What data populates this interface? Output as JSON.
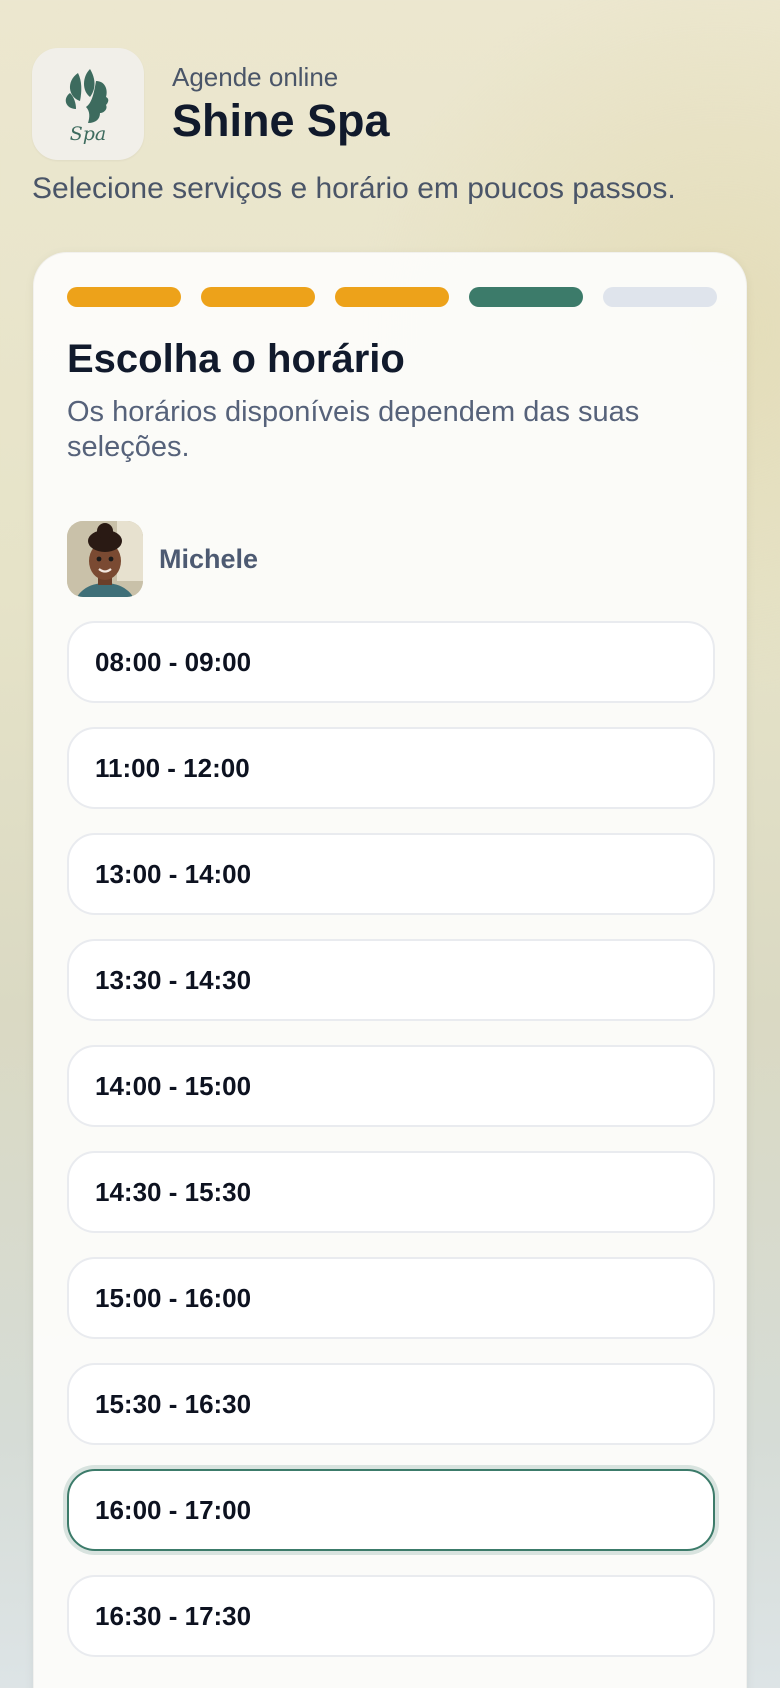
{
  "app": {
    "subtitle": "Agende online",
    "title": "Shine Spa",
    "logo_text": "Spa",
    "tagline": "Selecione serviços e horário em poucos passos."
  },
  "wizard": {
    "steps": [
      "done",
      "done",
      "done",
      "active",
      "pending"
    ],
    "step_colors": {
      "done": "#eda21a",
      "active": "#3c7b6a",
      "pending": "#dfe4ec"
    },
    "title": "Escolha o horário",
    "description": "Os horários disponíveis dependem das suas seleções."
  },
  "professional": {
    "name": "Michele"
  },
  "slots": [
    {
      "label": "08:00 - 09:00",
      "selected": false
    },
    {
      "label": "11:00 - 12:00",
      "selected": false
    },
    {
      "label": "13:00 - 14:00",
      "selected": false
    },
    {
      "label": "13:30 - 14:30",
      "selected": false
    },
    {
      "label": "14:00 - 15:00",
      "selected": false
    },
    {
      "label": "14:30 - 15:30",
      "selected": false
    },
    {
      "label": "15:00 - 16:00",
      "selected": false
    },
    {
      "label": "15:30 - 16:30",
      "selected": false
    },
    {
      "label": "16:00 - 17:00",
      "selected": true
    },
    {
      "label": "16:30 - 17:30",
      "selected": false
    }
  ]
}
